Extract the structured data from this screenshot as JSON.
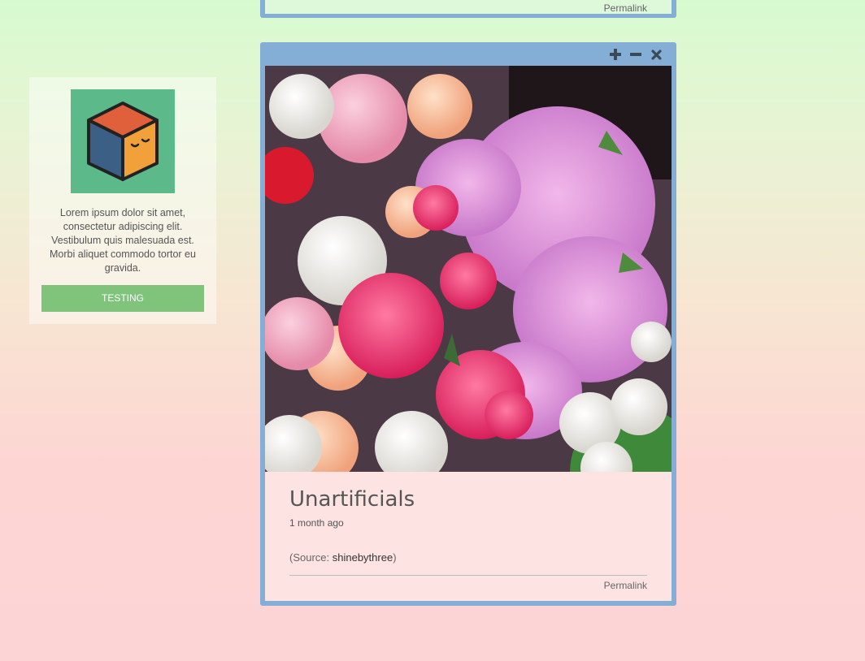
{
  "sidebar": {
    "avatar_icon": "sleepy-cube-icon",
    "description": "Lorem ipsum dolor sit amet, consectetur adipiscing elit. Vestibulum quis malesuada est. Morbi aliquet commodo tortor eu gravida.",
    "button_label": "TESTING"
  },
  "previous_post": {
    "permalink_label": "Permalink"
  },
  "post": {
    "controls": [
      {
        "name": "expand-icon"
      },
      {
        "name": "minimize-icon"
      },
      {
        "name": "close-icon"
      }
    ],
    "image_subject": "flower bouquets",
    "title": "Unartificials",
    "time_ago": "1 month ago",
    "source_prefix": "(Source: ",
    "source_link": "shinebythree",
    "source_suffix": ")",
    "permalink_label": "Permalink"
  },
  "colors": {
    "frame": "#84aed6",
    "button": "#7fc47a",
    "avatar_bg": "#5bb98a"
  }
}
